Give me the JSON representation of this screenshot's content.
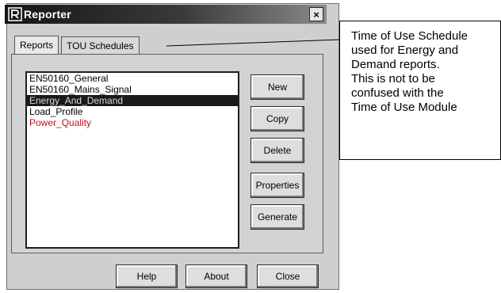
{
  "window": {
    "title": "Reporter",
    "close_label": "×"
  },
  "tabs": [
    {
      "label": "Reports",
      "active": true
    },
    {
      "label": "TOU Schedules",
      "active": false
    }
  ],
  "reports": [
    {
      "label": "EN50160_General",
      "selected": false,
      "color": "#000000"
    },
    {
      "label": "EN50160_Mains_Signal",
      "selected": false,
      "color": "#000000"
    },
    {
      "label": "Energy_And_Demand",
      "selected": true,
      "color": "#d9d9d9"
    },
    {
      "label": "Load_Profile",
      "selected": false,
      "color": "#000000"
    },
    {
      "label": "Power_Quality",
      "selected": false,
      "color": "#c40f1a"
    }
  ],
  "side_buttons": {
    "new": "New",
    "copy": "Copy",
    "delete": "Delete",
    "properties": "Properties",
    "generate": "Generate"
  },
  "bottom_buttons": {
    "help": "Help",
    "about": "About",
    "close": "Close"
  },
  "callout": {
    "lines": [
      "Time of Use Schedule",
      "used for Energy and",
      "Demand reports.",
      "This is not to be",
      "confused with the",
      "Time of Use Module"
    ]
  },
  "icons": {
    "app": "reporter-app-icon",
    "close": "close-icon"
  }
}
